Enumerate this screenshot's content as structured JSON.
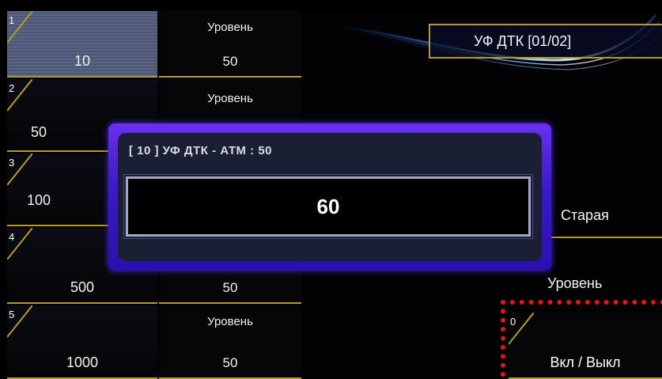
{
  "title_box": "УФ ДТК [01/02]",
  "rows": [
    {
      "num": "1",
      "value": "10",
      "level_label": "Уровень",
      "level_value": "50",
      "selected": true
    },
    {
      "num": "2",
      "value": "50",
      "level_label": "Уровень",
      "level_value": ""
    },
    {
      "num": "3",
      "value": "100",
      "level_label": "",
      "level_value": ""
    },
    {
      "num": "4",
      "value": "500",
      "level_label": "",
      "level_value": "50"
    },
    {
      "num": "5",
      "value": "1000",
      "level_label": "Уровень",
      "level_value": "50"
    }
  ],
  "right": {
    "old_label": "Старая",
    "level_label": "Уровень",
    "onoff": {
      "num": "0",
      "label": "Вкл / Выкл"
    }
  },
  "dialog": {
    "title": "[ 10 ] УФ ДТК - АТМ : 50",
    "value": "60"
  },
  "colors": {
    "accent": "#b59a2c",
    "highlight": "#e0161b",
    "dialog": "#4b2be0"
  }
}
